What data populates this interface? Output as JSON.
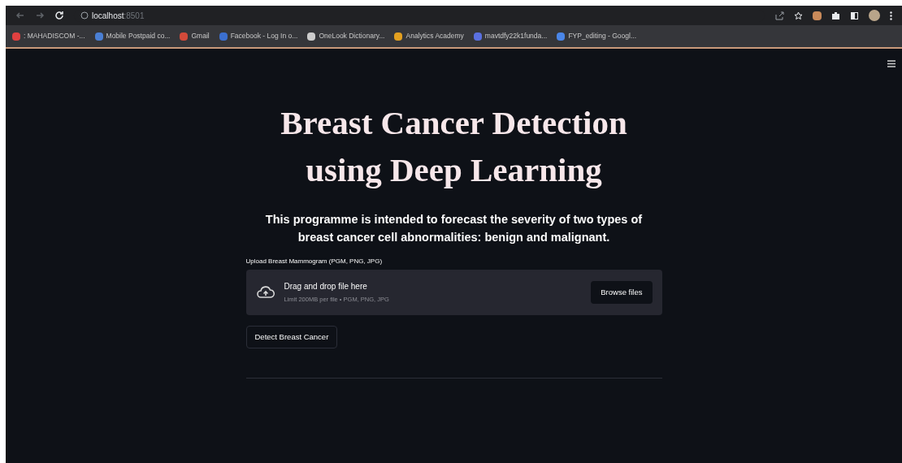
{
  "browser": {
    "url_host": "localhost",
    "url_port": ":8501",
    "bookmarks": [
      {
        "label": ": MAHADISCOM -...",
        "color": "#e04040"
      },
      {
        "label": "Mobile Postpaid co...",
        "color": "#4a7fd4"
      },
      {
        "label": "Gmail",
        "color": "#d44a3a"
      },
      {
        "label": "Facebook - Log In o...",
        "color": "#3b6fd0"
      },
      {
        "label": "OneLook Dictionary...",
        "color": "#cccccc"
      },
      {
        "label": "Analytics Academy",
        "color": "#e3a020"
      },
      {
        "label": "mavtdfy22k1funda...",
        "color": "#5a70e0"
      },
      {
        "label": "FYP_editing - Googl...",
        "color": "#4a86e8"
      }
    ]
  },
  "app": {
    "title_lines": [
      "Breast Cancer Detection",
      "using Deep Learning"
    ],
    "subtitle": "This programme is intended to forecast the severity of two types of breast cancer cell abnormalities: benign and malignant.",
    "uploader": {
      "label": "Upload Breast Mammogram (PGM, PNG, JPG)",
      "drop_text": "Drag and drop file here",
      "limit_text": "Limit 200MB per file • PGM, PNG, JPG",
      "browse_button": "Browse files"
    },
    "detect_button": "Detect Breast Cancer"
  }
}
